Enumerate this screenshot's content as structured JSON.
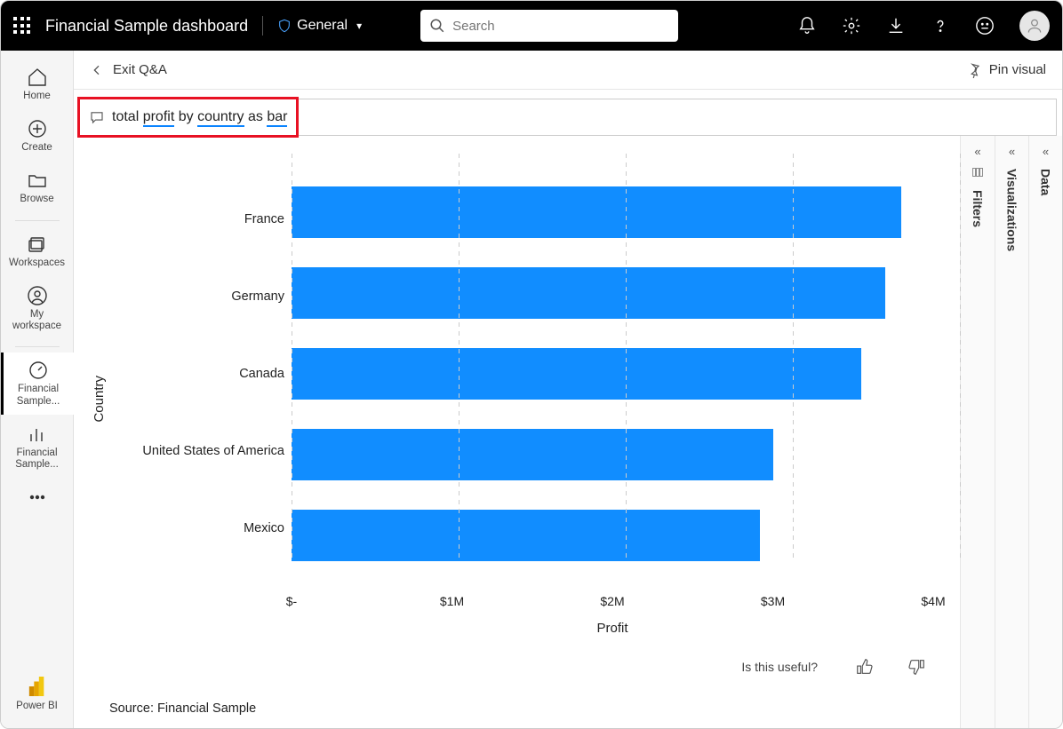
{
  "topbar": {
    "app_title": "Financial Sample dashboard",
    "sensitivity_label": "General",
    "search_placeholder": "Search"
  },
  "leftnav": {
    "home": "Home",
    "create": "Create",
    "browse": "Browse",
    "workspaces": "Workspaces",
    "my_workspace": "My workspace",
    "item_dashboard": "Financial Sample...",
    "item_report": "Financial Sample...",
    "footer": "Power BI"
  },
  "sechdr": {
    "exit_label": "Exit Q&A",
    "pin_label": "Pin visual"
  },
  "qna": {
    "prefix": "total ",
    "w1": "profit",
    "mid1": " by ",
    "w2": "country",
    "mid2": " as ",
    "w3": "bar"
  },
  "panels": {
    "filters": "Filters",
    "visualizations": "Visualizations",
    "data": "Data"
  },
  "footer": {
    "useful": "Is this useful?",
    "source": "Source: Financial Sample"
  },
  "chart_data": {
    "type": "bar",
    "orientation": "horizontal",
    "categories": [
      "France",
      "Germany",
      "Canada",
      "United States of America",
      "Mexico"
    ],
    "values": [
      3800000,
      3700000,
      3550000,
      3000000,
      2920000
    ],
    "xlabel": "Profit",
    "ylabel": "Country",
    "xlim": [
      0,
      4000000
    ],
    "x_ticks": [
      0,
      1000000,
      2000000,
      3000000,
      4000000
    ],
    "x_tick_labels": [
      "$-",
      "$1M",
      "$2M",
      "$3M",
      "$4M"
    ],
    "bar_color": "#118dff"
  }
}
